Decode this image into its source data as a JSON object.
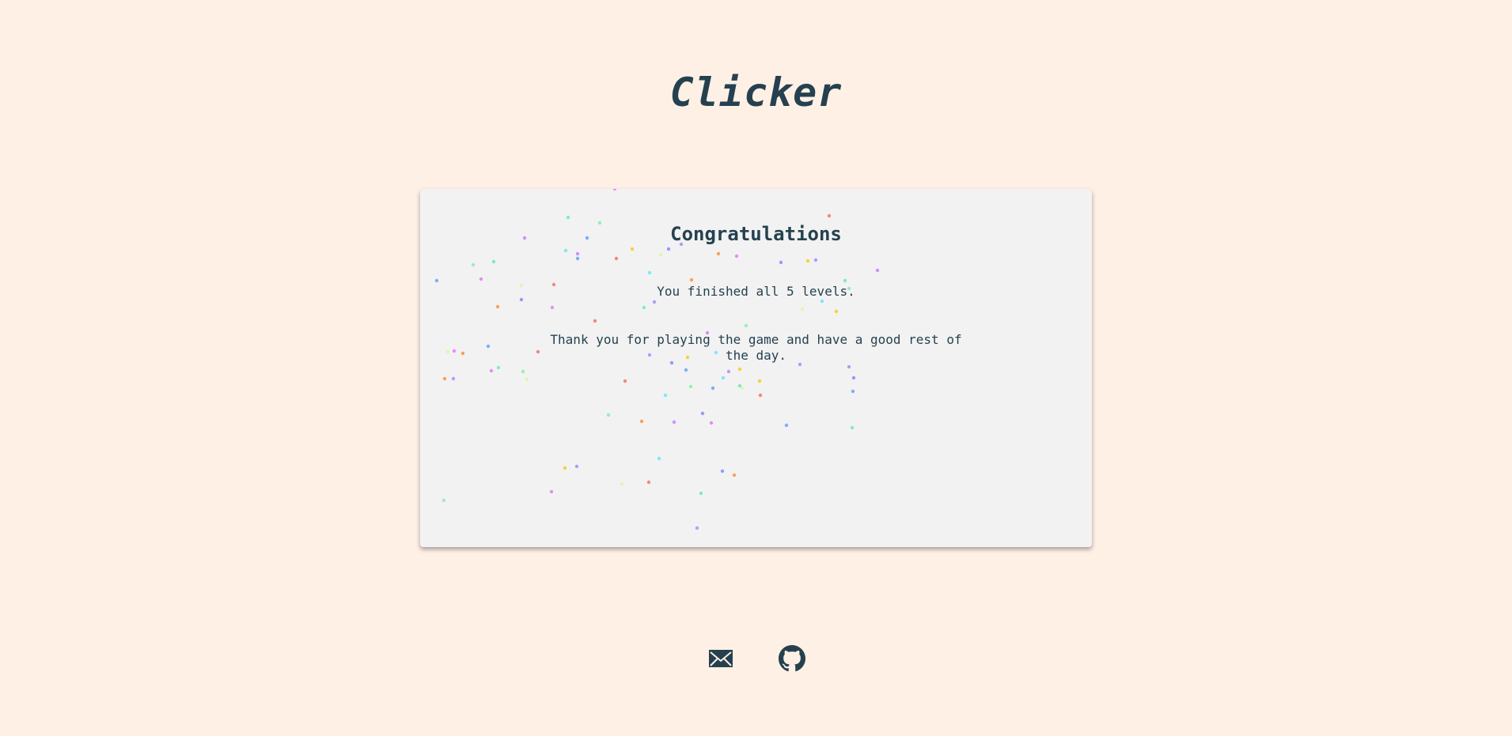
{
  "page": {
    "title": "Clicker"
  },
  "card": {
    "heading": "Congratulations",
    "message_levels": "You finished all 5 levels.",
    "message_thanks": "Thank you for playing the game and have a good rest of the day."
  },
  "footer": {
    "links": [
      {
        "icon": "mail-icon"
      },
      {
        "icon": "github-icon"
      }
    ]
  },
  "colors": {
    "background": "#fff0e6",
    "card_background": "#f2f2f2",
    "text": "#25414f",
    "confetti": [
      "#e879f9",
      "#67e8f9",
      "#f87171",
      "#a78bfa",
      "#86efac",
      "#fb923c",
      "#60a5fa",
      "#d9f99d",
      "#facc15",
      "#6ee7b7",
      "#818cf8",
      "#c084fc"
    ]
  }
}
